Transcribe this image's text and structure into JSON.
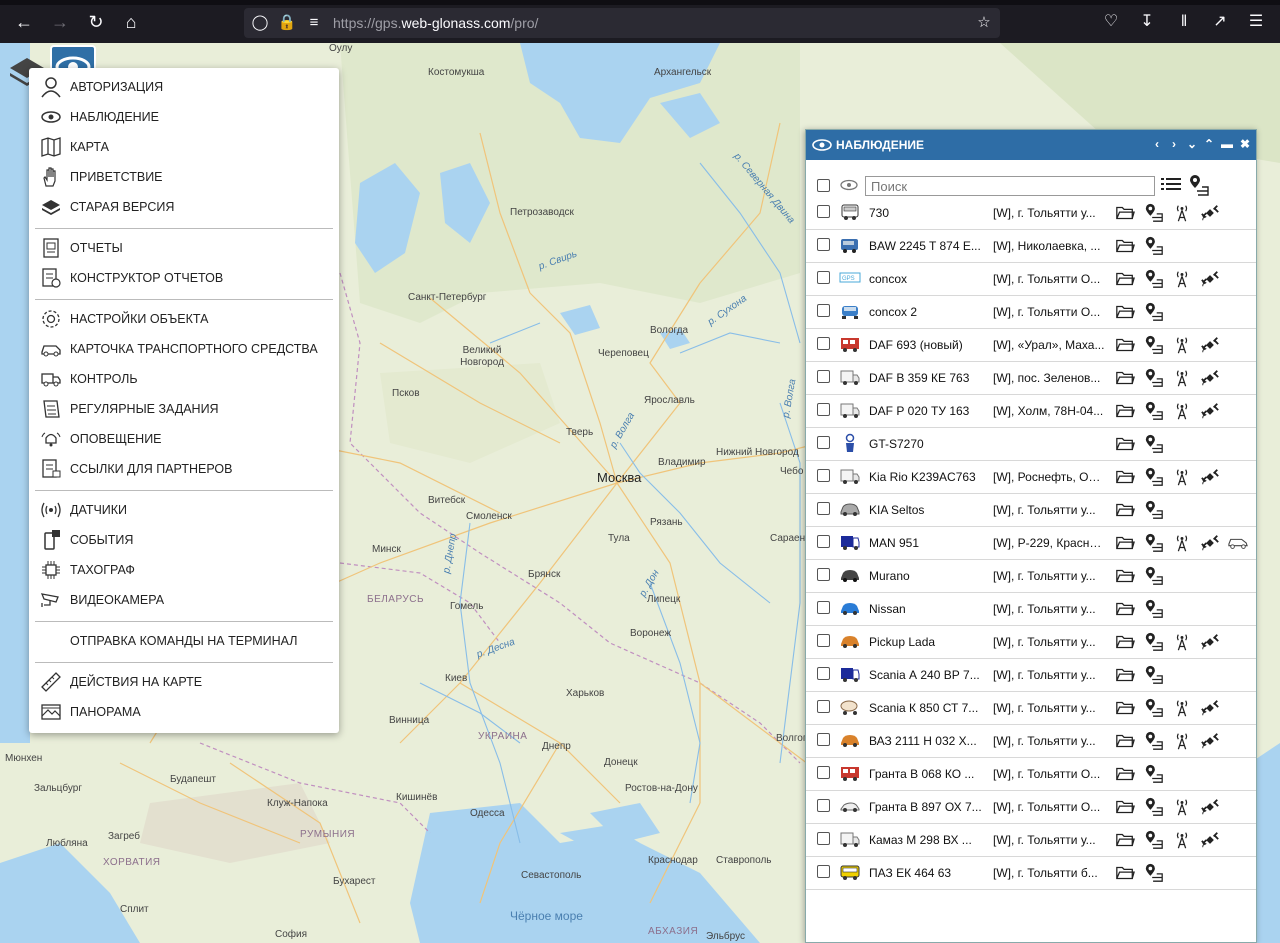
{
  "browser": {
    "url_prefix": "https://gps.",
    "url_host": "web-glonass.com",
    "url_path": "/pro/",
    "icons": [
      "back-icon",
      "forward-icon",
      "reload-icon",
      "home-icon",
      "shield-icon",
      "lock-icon",
      "permissions-icon",
      "star-icon",
      "pocket-icon",
      "download-icon",
      "library-icon",
      "extensions-icon",
      "menu-icon"
    ]
  },
  "map": {
    "labels": [
      {
        "t": "Оулу"
      },
      {
        "t": "Костомукша"
      },
      {
        "t": "Архангельск"
      },
      {
        "t": "Петрозаводск"
      },
      {
        "t": "Санкт-Петербург"
      },
      {
        "t": "Вологда"
      },
      {
        "t": "Великий Новгород"
      },
      {
        "t": "Череповец"
      },
      {
        "t": "Псков"
      },
      {
        "t": "Ярославль"
      },
      {
        "t": "Тверь"
      },
      {
        "t": "Москва"
      },
      {
        "t": "Владимир"
      },
      {
        "t": "Нижний Новгород"
      },
      {
        "t": "Витебск"
      },
      {
        "t": "Смоленск"
      },
      {
        "t": "Рязань"
      },
      {
        "t": "Тула"
      },
      {
        "t": "Минск"
      },
      {
        "t": "Брянск"
      },
      {
        "t": "БЕЛАРУСЬ"
      },
      {
        "t": "Гомель"
      },
      {
        "t": "Липецк"
      },
      {
        "t": "Воронеж"
      },
      {
        "t": "Киев"
      },
      {
        "t": "Харьков"
      },
      {
        "t": "Винница"
      },
      {
        "t": "УКРАИНА"
      },
      {
        "t": "Днепр"
      },
      {
        "t": "Донецк"
      },
      {
        "t": "Волгоград"
      },
      {
        "t": "Будапешт"
      },
      {
        "t": "Клуж-Напока"
      },
      {
        "t": "Кишинёв"
      },
      {
        "t": "Одесса"
      },
      {
        "t": "Ростов-на-Дону"
      },
      {
        "t": "Любляна"
      },
      {
        "t": "Загреб"
      },
      {
        "t": "РУМЫНИЯ"
      },
      {
        "t": "ХОРВАТИЯ"
      },
      {
        "t": "Краснодар"
      },
      {
        "t": "Ставрополь"
      },
      {
        "t": "Бухарест"
      },
      {
        "t": "Севастополь"
      },
      {
        "t": "Чёрное море"
      },
      {
        "t": "Сплит"
      },
      {
        "t": "София"
      },
      {
        "t": "АБХАЗИЯ"
      },
      {
        "t": "Эльбрус"
      },
      {
        "t": "Мюнхен"
      },
      {
        "t": "Зальцбург"
      },
      {
        "t": "Сараен"
      },
      {
        "t": "Чебо"
      },
      {
        "t": "р. Северная Двина"
      },
      {
        "t": "р. Свирь"
      },
      {
        "t": "р. Сухона"
      },
      {
        "t": "р. Волга"
      },
      {
        "t": "р. Дон"
      },
      {
        "t": "р. Днепр"
      },
      {
        "t": "р. Десна"
      },
      {
        "t": "р. Волга"
      }
    ]
  },
  "menu": {
    "items": [
      {
        "label": "АВТОРИЗАЦИЯ",
        "icon": "user-icon"
      },
      {
        "label": "НАБЛЮДЕНИЕ",
        "icon": "eye-icon"
      },
      {
        "label": "КАРТА",
        "icon": "map-icon"
      },
      {
        "label": "ПРИВЕТСТВИЕ",
        "icon": "hand-icon"
      },
      {
        "label": "СТАРАЯ ВЕРСИЯ",
        "icon": "layers-icon"
      },
      {
        "label": "ОТЧЕТЫ",
        "icon": "report-icon"
      },
      {
        "label": "КОНСТРУКТОР ОТЧЕТОВ",
        "icon": "report-builder-icon"
      },
      {
        "label": "НАСТРОЙКИ ОБЪЕКТА",
        "icon": "gear-icon"
      },
      {
        "label": "КАРТОЧКА ТРАНСПОРТНОГО СРЕДСТВА",
        "icon": "vehicle-card-icon"
      },
      {
        "label": "КОНТРОЛЬ",
        "icon": "truck-check-icon"
      },
      {
        "label": "РЕГУЛЯРНЫЕ ЗАДАНИЯ",
        "icon": "tasks-icon"
      },
      {
        "label": "ОПОВЕЩЕНИЕ",
        "icon": "bell-icon"
      },
      {
        "label": "ССЫЛКИ ДЛЯ ПАРТНЕРОВ",
        "icon": "partner-links-icon"
      },
      {
        "label": "ДАТЧИКИ",
        "icon": "sensor-icon"
      },
      {
        "label": "СОБЫТИЯ",
        "icon": "events-icon"
      },
      {
        "label": "ТАХОГРАФ",
        "icon": "tachograph-icon"
      },
      {
        "label": "ВИДЕОКАМЕРА",
        "icon": "camera-icon"
      },
      {
        "label": "ОТПРАВКА КОМАНДЫ НА ТЕРМИНАЛ",
        "icon": ""
      },
      {
        "label": "ДЕЙСТВИЯ НА КАРТЕ",
        "icon": "ruler-icon"
      },
      {
        "label": "ПАНОРАМА",
        "icon": "panorama-icon"
      }
    ]
  },
  "panel": {
    "title": "НАБЛЮДЕНИЕ",
    "search_placeholder": "Поиск",
    "header_icons": [
      "prev-icon",
      "next-icon",
      "down-icon",
      "up-icon",
      "minimize-icon",
      "close-icon"
    ],
    "rows": [
      {
        "name": "730",
        "addr": "[W], г. Тольятти у...",
        "vehicle": "bus",
        "icons": [
          "folder",
          "track",
          "antenna",
          "satellite"
        ]
      },
      {
        "name": "BAW 2245 T 874 E...",
        "addr": "[W], Николаевка, ...",
        "vehicle": "van",
        "icons": [
          "folder",
          "track"
        ]
      },
      {
        "name": "concox",
        "addr": "[W], г. Тольятти О...",
        "vehicle": "device",
        "icons": [
          "folder",
          "track",
          "antenna",
          "satellite"
        ]
      },
      {
        "name": "concox 2",
        "addr": "[W], г. Тольятти О...",
        "vehicle": "car-front",
        "icons": [
          "folder",
          "track"
        ]
      },
      {
        "name": "DAF 693 (новый)",
        "addr": "[W], «Урал», Маха...",
        "vehicle": "train",
        "icons": [
          "folder",
          "track",
          "antenna",
          "satellite"
        ]
      },
      {
        "name": "DAF В 359 КЕ 763",
        "addr": "[W], пос. Зеленов...",
        "vehicle": "truck",
        "icons": [
          "folder",
          "track",
          "antenna",
          "satellite"
        ]
      },
      {
        "name": "DAF Р 020 ТУ 163",
        "addr": "[W], Холм, 78Н-04...",
        "vehicle": "truck",
        "icons": [
          "folder",
          "track",
          "antenna",
          "satellite"
        ]
      },
      {
        "name": "GT-S7270",
        "addr": "",
        "vehicle": "person",
        "icons": [
          "folder",
          "track"
        ]
      },
      {
        "name": "Kia Rio K239AC763",
        "addr": "[W], Роснефть, Ол...",
        "vehicle": "truck",
        "icons": [
          "folder",
          "track",
          "antenna",
          "satellite"
        ]
      },
      {
        "name": "KIA Seltos",
        "addr": "[W], г. Тольятти у...",
        "vehicle": "car-grey",
        "icons": [
          "folder",
          "track"
        ]
      },
      {
        "name": "MAN 951",
        "addr": "[W], Р-229, Красно...",
        "vehicle": "truck-blue",
        "icons": [
          "folder",
          "track",
          "antenna",
          "satellite",
          "car-outline"
        ]
      },
      {
        "name": "Murano",
        "addr": "[W], г. Тольятти у...",
        "vehicle": "car-dark",
        "icons": [
          "folder",
          "track"
        ]
      },
      {
        "name": "Nissan",
        "addr": "[W], г. Тольятти у...",
        "vehicle": "car-blue",
        "icons": [
          "folder",
          "track"
        ]
      },
      {
        "name": "Pickup Lada",
        "addr": "[W], г. Тольятти у...",
        "vehicle": "car-orange",
        "icons": [
          "folder",
          "track",
          "antenna",
          "satellite"
        ]
      },
      {
        "name": "Scania А 240 ВР 7...",
        "addr": "[W], г. Тольятти у...",
        "vehicle": "truck-blue",
        "icons": [
          "folder",
          "track"
        ]
      },
      {
        "name": "Scania К 850 СТ 7...",
        "addr": "[W], г. Тольятти у...",
        "vehicle": "tanker",
        "icons": [
          "folder",
          "track",
          "antenna",
          "satellite"
        ]
      },
      {
        "name": "ВАЗ 2111 Н 032 Х...",
        "addr": "[W], г. Тольятти у...",
        "vehicle": "car-orange",
        "icons": [
          "folder",
          "track",
          "antenna",
          "satellite"
        ]
      },
      {
        "name": "Гранта В 068 КО ...",
        "addr": "[W], г. Тольятти О...",
        "vehicle": "train",
        "icons": [
          "folder",
          "track"
        ]
      },
      {
        "name": "Гранта В 897 ОХ 7...",
        "addr": "[W], г. Тольятти О...",
        "vehicle": "car-small",
        "icons": [
          "folder",
          "track",
          "antenna",
          "satellite"
        ]
      },
      {
        "name": "Камаз М 298 ВХ ...",
        "addr": "[W], г. Тольятти у...",
        "vehicle": "truck",
        "icons": [
          "folder",
          "track",
          "antenna",
          "satellite"
        ]
      },
      {
        "name": "ПАЗ ЕК 464 63",
        "addr": "[W], г. Тольятти б...",
        "vehicle": "bus-yellow",
        "icons": [
          "folder",
          "track"
        ]
      }
    ]
  }
}
